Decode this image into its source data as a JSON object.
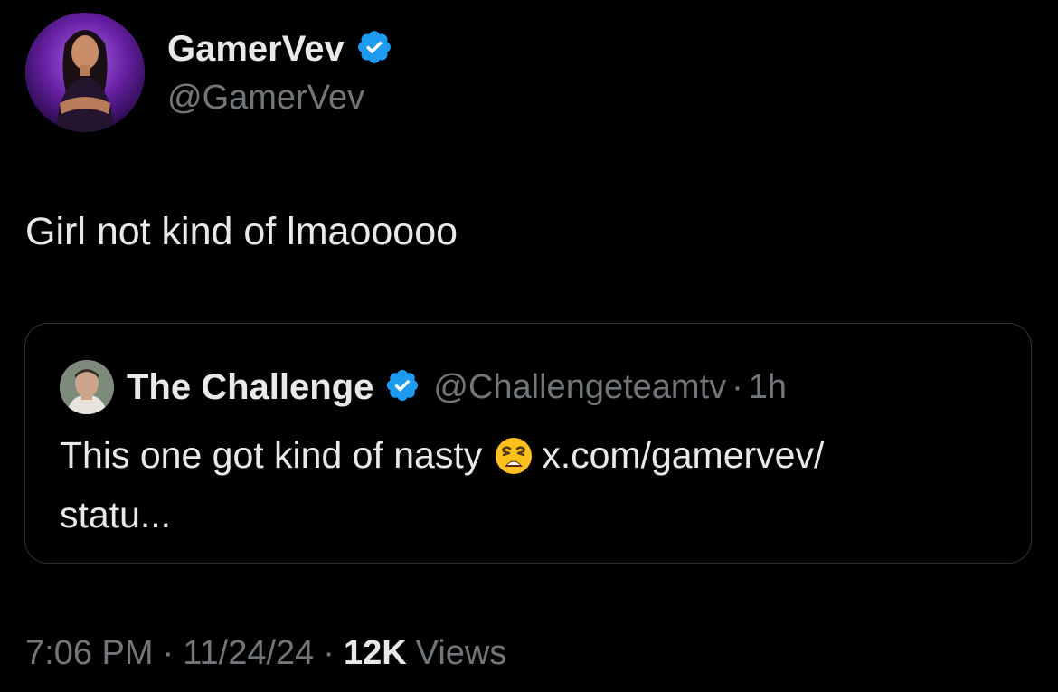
{
  "author": {
    "display_name": "GamerVev",
    "handle": "@GamerVev",
    "verified": true,
    "avatar_icon": "profile-photo-purple"
  },
  "tweet": {
    "text": "Girl not kind of lmaooooo"
  },
  "quoted_tweet": {
    "display_name": "The Challenge",
    "handle": "@Challengeteamtv",
    "separator": "·",
    "time": "1h",
    "text_line1_before": "This one got kind of nasty",
    "emoji_icon": "weary-face-emoji",
    "text_line1_after": "x.com/gamervev/",
    "text_line2": "statu..."
  },
  "meta": {
    "time": "7:06 PM",
    "separator": "·",
    "date": "11/24/24",
    "views_count": "12K",
    "views_label": "Views"
  },
  "colors": {
    "background": "#000000",
    "primary_text": "#e7e9ea",
    "secondary_text": "#71767b",
    "verified_blue": "#1d9bf0",
    "border": "#2f3336"
  }
}
